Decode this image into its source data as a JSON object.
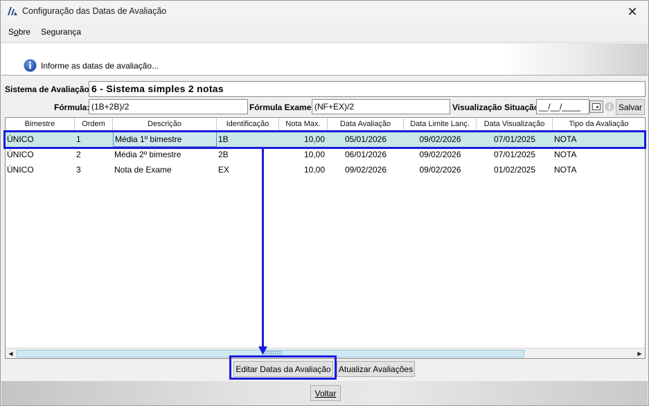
{
  "window": {
    "title": "Configuração das Datas de Avaliação",
    "close_label": "✕"
  },
  "menu": {
    "items": [
      {
        "prefix": "S",
        "underline": "o",
        "suffix": "bre"
      },
      {
        "label": "Segurança"
      }
    ]
  },
  "info": {
    "text": "Informe as datas de avaliação..."
  },
  "form": {
    "sistema_label": "Sistema de Avaliação:",
    "sistema_value": "6 - Sistema simples 2 notas",
    "formula_label": "Fórmula:",
    "formula_value": "(1B+2B)/2",
    "formula_exame_label": "Fórmula Exame:",
    "formula_exame_value": "(NF+EX)/2",
    "visualizacao_label": "Visualização Situação:",
    "visualizacao_value": "__/__/____",
    "salvar_label": "Salvar"
  },
  "table": {
    "columns": [
      "Bimestre",
      "Ordem",
      "Descrição",
      "Identificação",
      "Nota Max.",
      "Data Avaliação",
      "Data Limite Lanç.",
      "Data Visualização",
      "Tipo da Avaliação"
    ],
    "rows": [
      {
        "bimestre": "ÚNICO",
        "ordem": "1",
        "descricao": "Média 1º bimestre",
        "identificacao": "1B",
        "nota_max": "10,00",
        "data_avaliacao": "05/01/2026",
        "data_limite": "09/02/2026",
        "data_visualizacao": "07/01/2025",
        "tipo": "NOTA",
        "selected": true
      },
      {
        "bimestre": "ÚNICO",
        "ordem": "2",
        "descricao": "Média 2º bimestre",
        "identificacao": "2B",
        "nota_max": "10,00",
        "data_avaliacao": "06/01/2026",
        "data_limite": "09/02/2026",
        "data_visualizacao": "07/01/2025",
        "tipo": "NOTA",
        "selected": false
      },
      {
        "bimestre": "ÚNICO",
        "ordem": "3",
        "descricao": "Nota de Exame",
        "identificacao": "EX",
        "nota_max": "10,00",
        "data_avaliacao": "09/02/2026",
        "data_limite": "09/02/2026",
        "data_visualizacao": "01/02/2025",
        "tipo": "NOTA",
        "selected": false
      }
    ]
  },
  "actions": {
    "editar_label": "Editar Datas da Avaliação",
    "atualizar_label": "Atualizar Avaliações"
  },
  "footer": {
    "voltar_label": "Voltar"
  },
  "colors": {
    "selected_row": "#c8e8e8",
    "annotation": "#1a1adf"
  }
}
